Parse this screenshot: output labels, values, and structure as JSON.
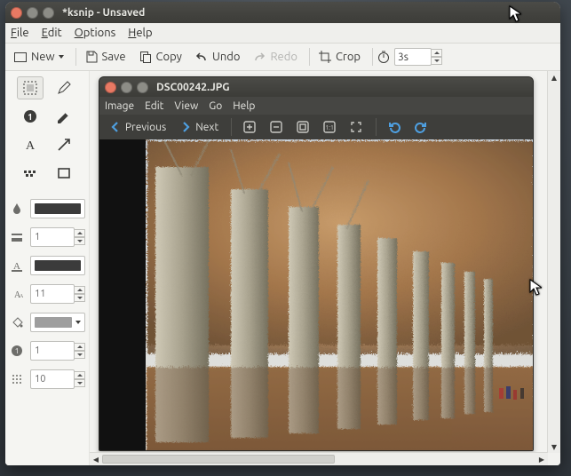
{
  "outer": {
    "title": "*ksnip - Unsaved",
    "menu": {
      "file": "File",
      "edit": "Edit",
      "options": "Options",
      "help": "Help"
    },
    "toolbar": {
      "new": "New",
      "save": "Save",
      "copy": "Copy",
      "undo": "Undo",
      "redo": "Redo",
      "crop": "Crop",
      "delay_value": "3s"
    }
  },
  "palette": {
    "stroke_color": "#3b3b3b",
    "stroke_width": "1",
    "font_color": "#3b3b3b",
    "font_size": "11",
    "fill_color": "#9e9e9e",
    "obfuscate": "1",
    "grid": "10"
  },
  "inner": {
    "title": "DSC00242.JPG",
    "menu": {
      "image": "Image",
      "edit": "Edit",
      "view": "View",
      "go": "Go",
      "help": "Help"
    },
    "toolbar": {
      "previous": "Previous",
      "next": "Next"
    }
  }
}
